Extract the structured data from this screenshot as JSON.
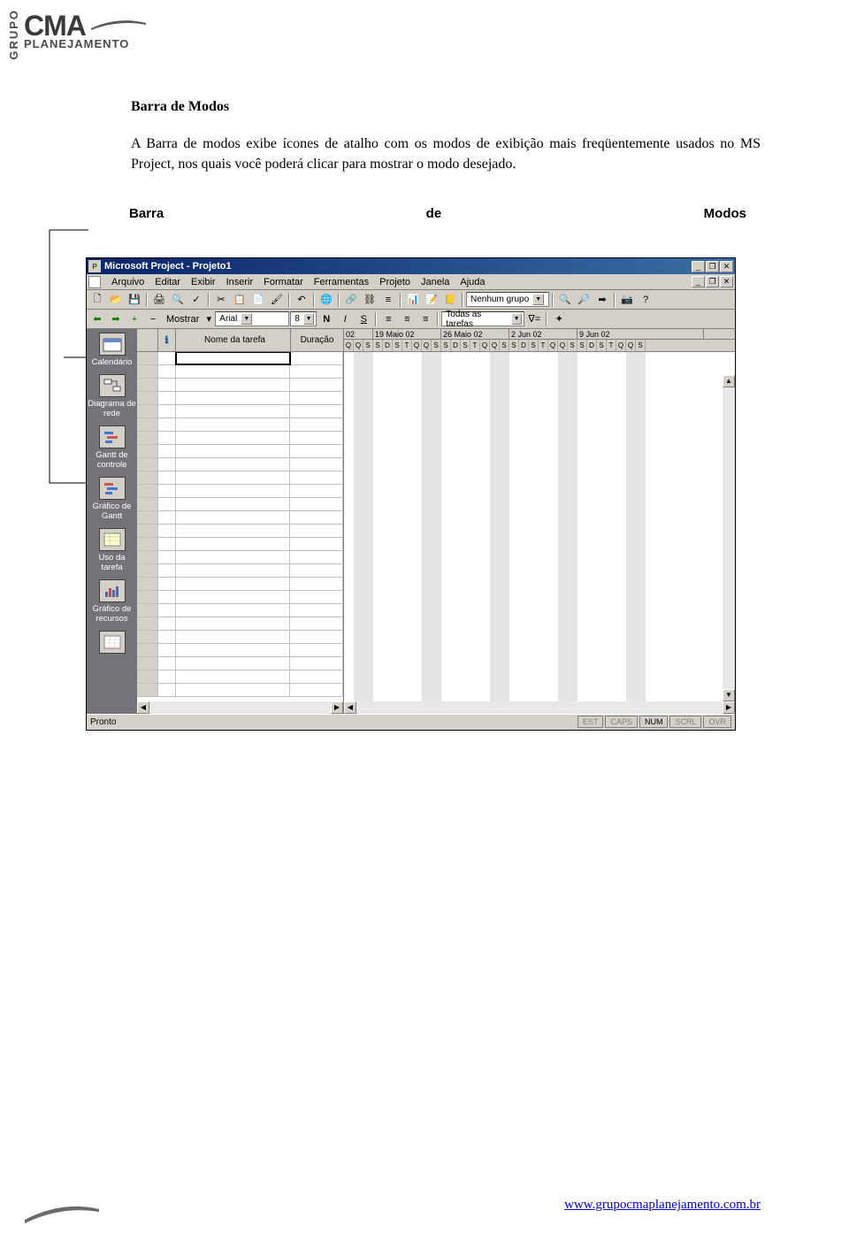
{
  "logo": {
    "grupo": "GRUPO",
    "main": "CMA",
    "sub": "PLANEJAMENTO"
  },
  "doc": {
    "heading": "Barra de Modos",
    "paragraph": "A Barra de modos exibe ícones de atalho com os modos de exibição mais freqüentemente usados no MS Project, nos quais você poderá clicar para mostrar o modo desejado.",
    "callout": {
      "w1": "Barra",
      "w2": "de",
      "w3": "Modos"
    }
  },
  "app": {
    "title": "Microsoft Project - Projeto1",
    "menus": [
      "Arquivo",
      "Editar",
      "Exibir",
      "Inserir",
      "Formatar",
      "Ferramentas",
      "Projeto",
      "Janela",
      "Ajuda"
    ],
    "toolbar1": {
      "group_combo": "Nenhum grupo"
    },
    "toolbar2": {
      "show_label": "Mostrar",
      "font": "Arial",
      "size": "8",
      "filter": "Todas as tarefas"
    },
    "viewbar": [
      {
        "label": "Calendário"
      },
      {
        "label": "Diagrama de rede"
      },
      {
        "label": "Gantt de controle"
      },
      {
        "label": "Gráfico de Gantt"
      },
      {
        "label": "Uso da tarefa"
      },
      {
        "label": "Gráfico de recursos"
      },
      {
        "label": ""
      }
    ],
    "grid": {
      "col_name": "Nome da tarefa",
      "col_dur": "Duração",
      "timeline_weeks": [
        "02",
        "19 Maio 02",
        "26 Maio 02",
        "2 Jun 02",
        "9 Jun 02"
      ],
      "timeline_width": [
        33,
        77,
        77,
        77,
        143
      ],
      "timeline_days": [
        "Q",
        "Q",
        "S",
        "S",
        "D",
        "S",
        "T",
        "Q",
        "Q",
        "S",
        "S",
        "D",
        "S",
        "T",
        "Q",
        "Q",
        "S",
        "S",
        "D",
        "S",
        "T",
        "Q",
        "Q",
        "S",
        "S",
        "D",
        "S",
        "T",
        "Q",
        "Q",
        "S"
      ]
    },
    "status": {
      "ready": "Pronto",
      "indicators": [
        {
          "label": "EST",
          "on": false
        },
        {
          "label": "CAPS",
          "on": false
        },
        {
          "label": "NUM",
          "on": true
        },
        {
          "label": "SCRL",
          "on": false
        },
        {
          "label": "OVR",
          "on": false
        }
      ]
    }
  },
  "footer": {
    "url": "www.grupocmaplanejamento.com.br"
  }
}
